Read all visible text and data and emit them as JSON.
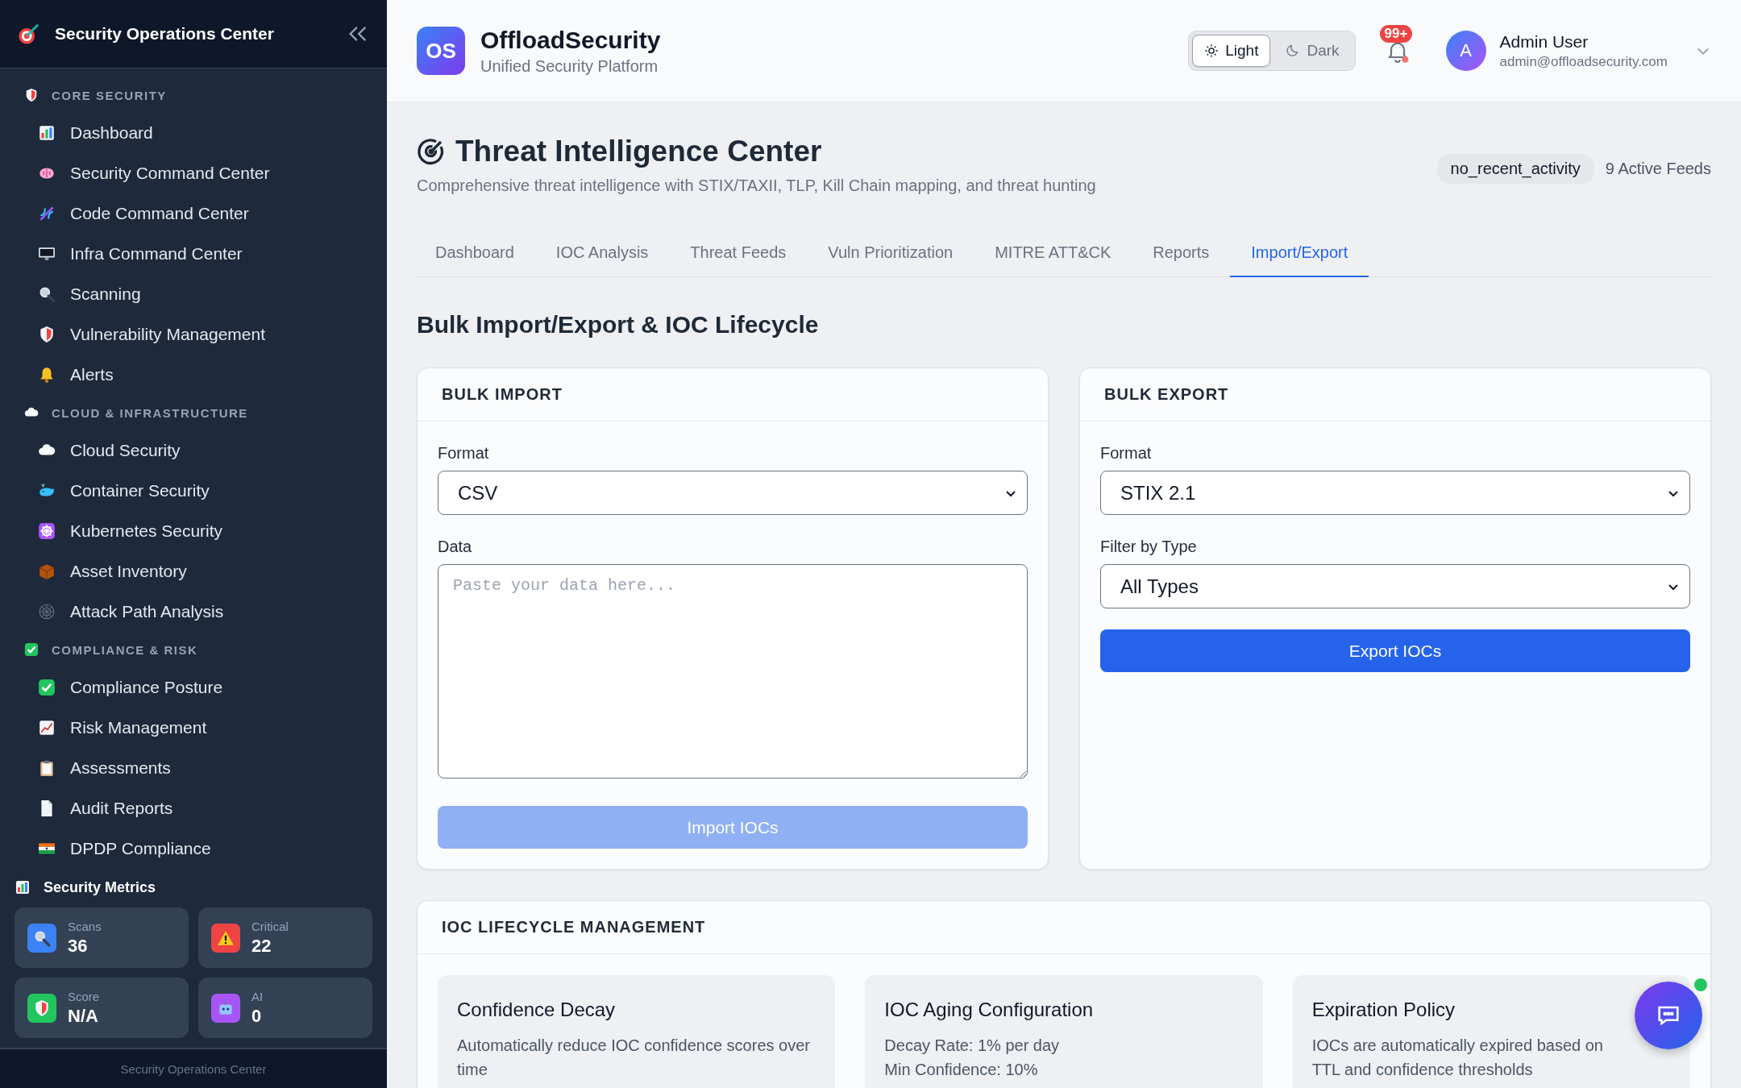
{
  "sidebar": {
    "title": "Security Operations Center",
    "sections": [
      {
        "label": "CORE SECURITY",
        "items": [
          {
            "label": "Dashboard"
          },
          {
            "label": "Security Command Center"
          },
          {
            "label": "Code Command Center"
          },
          {
            "label": "Infra Command Center"
          },
          {
            "label": "Scanning"
          },
          {
            "label": "Vulnerability Management"
          },
          {
            "label": "Alerts"
          }
        ]
      },
      {
        "label": "CLOUD & INFRASTRUCTURE",
        "items": [
          {
            "label": "Cloud Security"
          },
          {
            "label": "Container Security"
          },
          {
            "label": "Kubernetes Security"
          },
          {
            "label": "Asset Inventory"
          },
          {
            "label": "Attack Path Analysis"
          }
        ]
      },
      {
        "label": "COMPLIANCE & RISK",
        "items": [
          {
            "label": "Compliance Posture"
          },
          {
            "label": "Risk Management"
          },
          {
            "label": "Assessments"
          },
          {
            "label": "Audit Reports"
          },
          {
            "label": "DPDP Compliance"
          }
        ]
      }
    ],
    "metrics": {
      "title": "Security Metrics",
      "cards": [
        {
          "label": "Scans",
          "value": "36",
          "color": "#3b82f6"
        },
        {
          "label": "Critical",
          "value": "22",
          "color": "#ef4444"
        },
        {
          "label": "Score",
          "value": "N/A",
          "color": "#22c55e"
        },
        {
          "label": "AI",
          "value": "0",
          "color": "#a855f7"
        }
      ]
    },
    "footer": "Security Operations Center"
  },
  "header": {
    "logo": "OS",
    "brand": "OffloadSecurity",
    "subtitle": "Unified Security Platform",
    "theme": [
      {
        "label": "Light",
        "selected": true
      },
      {
        "label": "Dark",
        "selected": false
      }
    ],
    "notifications": "99+",
    "user": {
      "initial": "A",
      "name": "Admin User",
      "email": "admin@offloadsecurity.com"
    }
  },
  "page": {
    "title": "Threat Intelligence Center",
    "subtitle": "Comprehensive threat intelligence with STIX/TAXII, TLP, Kill Chain mapping, and threat hunting",
    "status": "no_recent_activity",
    "feeds": "9 Active Feeds",
    "tabs": [
      {
        "label": "Dashboard",
        "selected": false
      },
      {
        "label": "IOC Analysis",
        "selected": false
      },
      {
        "label": "Threat Feeds",
        "selected": false
      },
      {
        "label": "Vuln Prioritization",
        "selected": false
      },
      {
        "label": "MITRE ATT&CK",
        "selected": false
      },
      {
        "label": "Reports",
        "selected": false
      },
      {
        "label": "Import/Export",
        "selected": true
      }
    ],
    "section_title": "Bulk Import/Export & IOC Lifecycle",
    "import": {
      "title": "BULK IMPORT",
      "format_label": "Format",
      "format": "CSV",
      "data_label": "Data",
      "data_placeholder": "Paste your data here...",
      "button": "Import IOCs",
      "button_disabled": true
    },
    "export": {
      "title": "BULK EXPORT",
      "format_label": "Format",
      "format": "STIX 2.1",
      "filter_label": "Filter by Type",
      "filter": "All Types",
      "button": "Export IOCs"
    },
    "lifecycle": {
      "title": "IOC LIFECYCLE MANAGEMENT",
      "cards": [
        {
          "title": "Confidence Decay",
          "lines": [
            "Automatically reduce IOC confidence scores over time"
          ]
        },
        {
          "title": "IOC Aging Configuration",
          "lines": [
            "Decay Rate: 1% per day",
            "Min Confidence: 10%"
          ]
        },
        {
          "title": "Expiration Policy",
          "lines": [
            "IOCs are automatically expired based on TTL and confidence thresholds"
          ]
        }
      ]
    }
  }
}
